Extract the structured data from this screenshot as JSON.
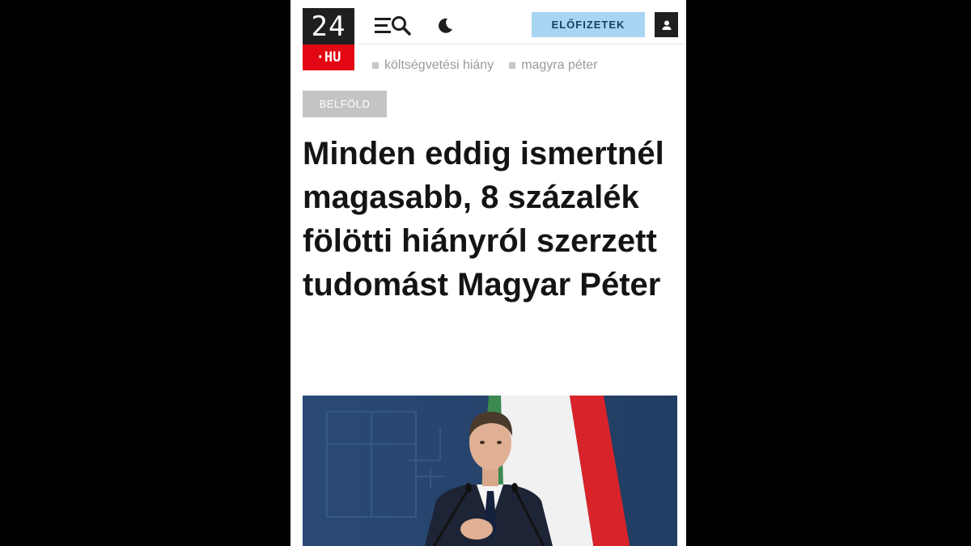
{
  "header": {
    "logo_top": "24",
    "logo_bottom": "·HU",
    "subscribe_label": "ELŐFIZETEK"
  },
  "tags": [
    "költségvetési hiány",
    "magyra péter"
  ],
  "article": {
    "category": "BELFÖLD",
    "headline": "Minden eddig ismertnél magasabb, 8 százalék fölötti hiányról szerzett tudomást Magyar Péter"
  },
  "colors": {
    "logo_dark": "#1f1f1f",
    "logo_red": "#e30613",
    "subscribe_bg": "#a7d5f2",
    "subscribe_text": "#1b3e67",
    "category_bg": "#c4c4c4"
  },
  "icons": [
    "menu-search-icon",
    "moon-icon",
    "user-icon"
  ]
}
